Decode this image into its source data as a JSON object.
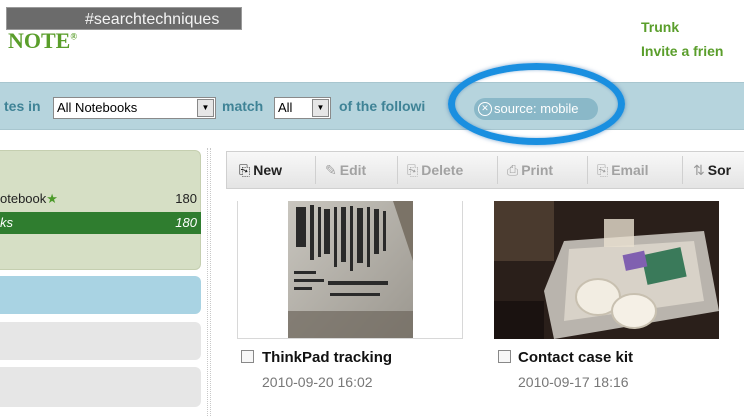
{
  "overlay_tag": "#searchtechniques",
  "logo": {
    "text": "NOTE",
    "mark": "®"
  },
  "top_links": [
    "Trunk",
    "Invite a frien"
  ],
  "search": {
    "prefix": "tes in",
    "notebook_select": "All Notebooks",
    "match_label": "match",
    "match_select": "All",
    "suffix": "of the followi",
    "chip_label": "source: mobile"
  },
  "sidebar": {
    "notebooks": [
      {
        "name": "otebook",
        "count": "180"
      },
      {
        "name": "ks",
        "count": "180"
      }
    ]
  },
  "toolbar": {
    "new": "New",
    "edit": "Edit",
    "delete": "Delete",
    "print": "Print",
    "email": "Email",
    "sort": "Sor"
  },
  "notes": [
    {
      "title": "ThinkPad tracking",
      "date": "2010-09-20 16:02"
    },
    {
      "title": "Contact case kit",
      "date": "2010-09-17 18:16"
    }
  ],
  "colors": {
    "brand_green": "#5a9e2b",
    "ring_blue": "#1a8fe0",
    "search_bar": "#b6d4dd",
    "selected_notebook": "#2f7d2f"
  }
}
